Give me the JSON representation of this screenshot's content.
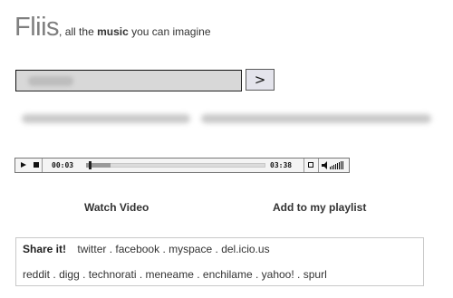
{
  "header": {
    "logo": "Fliis",
    "tagline_pre": ", all the ",
    "tagline_bold": "music",
    "tagline_post": " you can imagine"
  },
  "search": {
    "value": "",
    "placeholder": "",
    "go_label": ">"
  },
  "player": {
    "current_time": "00:03",
    "total_time": "03:38",
    "progress": 0.015
  },
  "actions": {
    "watch_video": "Watch Video",
    "add_to_playlist": "Add to my playlist"
  },
  "share": {
    "label": "Share it!",
    "row1": [
      "twitter",
      "facebook",
      "myspace",
      "del.icio.us"
    ],
    "row2": [
      "reddit",
      "digg",
      "technorati",
      "meneame",
      "enchilame",
      "yahoo!",
      "spurl"
    ],
    "separator": "."
  },
  "colors": {
    "logo": "#7f7f7f",
    "input_bg": "#d8d8d8",
    "button_bg": "#e4e4ec",
    "text": "#333333"
  }
}
